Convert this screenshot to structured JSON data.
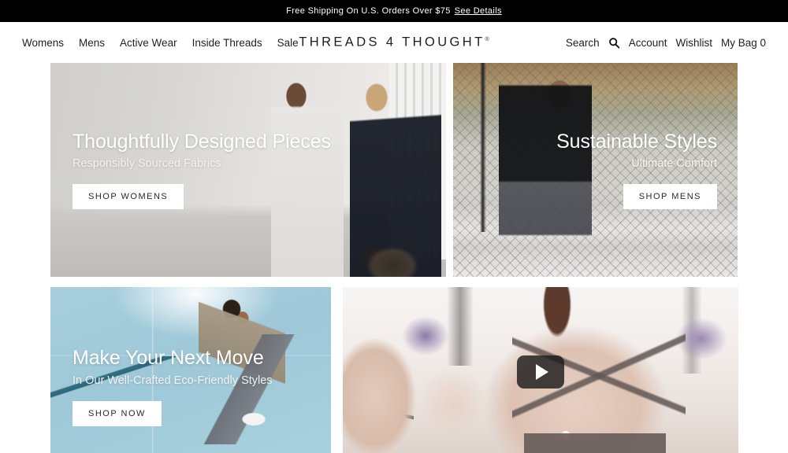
{
  "announcement": {
    "text": "Free Shipping On U.S. Orders Over $75",
    "link_label": "See Details"
  },
  "header": {
    "logo": "THREADS 4 THOUGHT",
    "logo_mark": "®",
    "nav_left": [
      {
        "label": "Womens"
      },
      {
        "label": "Mens"
      },
      {
        "label": "Active Wear"
      },
      {
        "label": "Inside Threads"
      },
      {
        "label": "Sale"
      }
    ],
    "nav_right": [
      {
        "label": "Search"
      },
      {
        "label": "Account"
      },
      {
        "label": "Wishlist"
      },
      {
        "label": "My Bag 0"
      }
    ],
    "search_icon": "search-icon"
  },
  "hero": {
    "tiles": [
      {
        "id": "womens",
        "heading": "Thoughtfully Designed Pieces",
        "subheading": "Responsibly Sourced Fabrics",
        "button": "SHOP WOMENS"
      },
      {
        "id": "mens",
        "heading": "Sustainable Styles",
        "subheading": "Ultimate Comfort",
        "button": "SHOP MENS"
      },
      {
        "id": "move",
        "heading": "Make Your Next Move",
        "subheading": "In Our Well-Crafted Eco-Friendly Styles",
        "button": "SHOP NOW"
      },
      {
        "id": "video",
        "play_icon": "play-icon"
      }
    ]
  },
  "colors": {
    "announcement_bg": "#000000",
    "page_bg": "#ffffff",
    "text": "#222222",
    "button_bg": "#ffffff",
    "button_text": "#2a2a2a",
    "move_tile_bg": "#a7cfdd"
  }
}
